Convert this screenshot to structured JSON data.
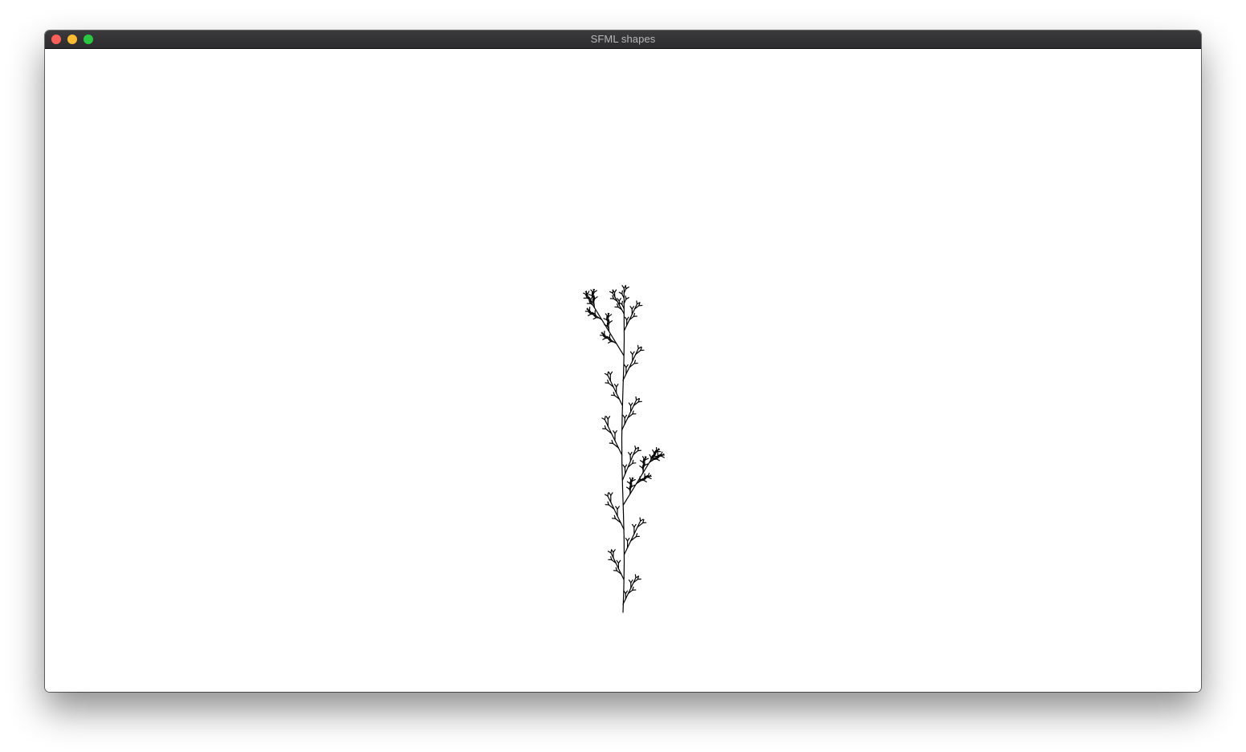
{
  "window": {
    "title": "SFML shapes",
    "controls": [
      {
        "name": "close",
        "color": "#ff5f57"
      },
      {
        "name": "minimize",
        "color": "#febc2e"
      },
      {
        "name": "maximize",
        "color": "#28c840"
      }
    ]
  },
  "canvas": {
    "background": "#ffffff",
    "drawing": "fractal-plant",
    "stroke_color": "#000000"
  }
}
